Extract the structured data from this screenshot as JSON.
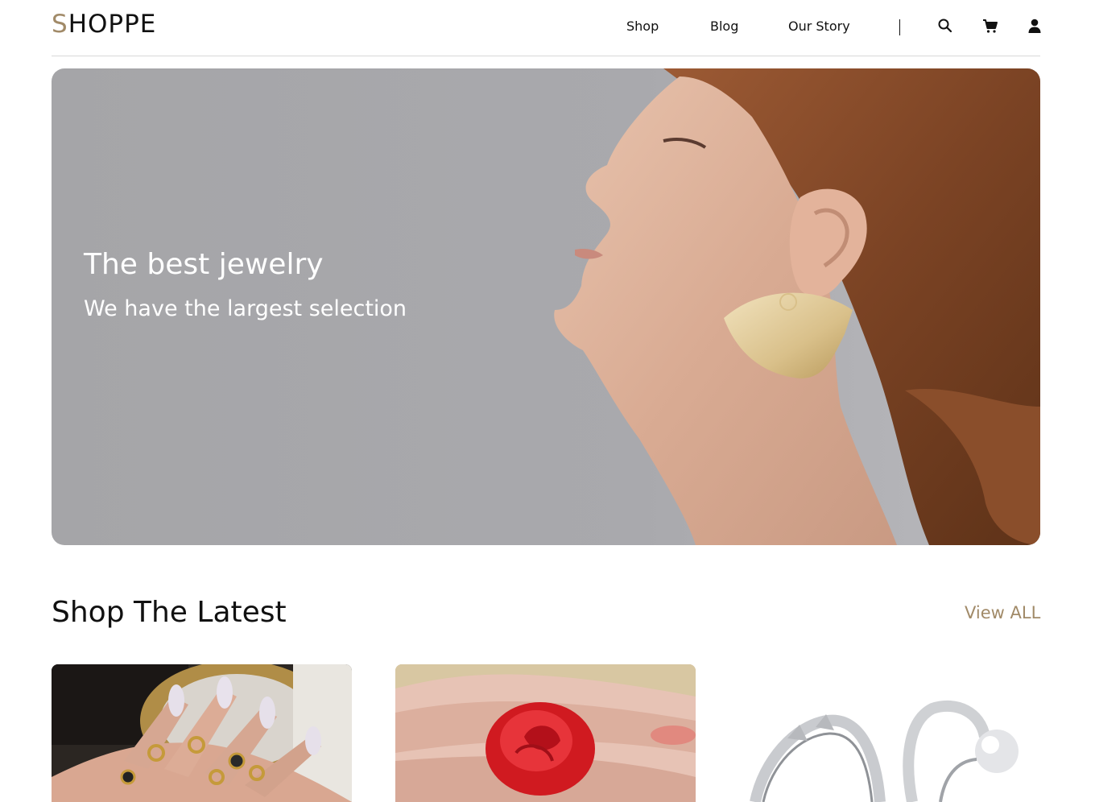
{
  "header": {
    "logo_first": "S",
    "logo_rest": "HOPPE",
    "nav": [
      {
        "label": "Shop"
      },
      {
        "label": "Blog"
      },
      {
        "label": "Our Story"
      }
    ],
    "icons": [
      "search-icon",
      "cart-icon",
      "user-icon"
    ]
  },
  "hero": {
    "title": "The best jewelry",
    "subtitle": "We have the largest selection"
  },
  "latest": {
    "title": "Shop The Latest",
    "view_all": "View ALL",
    "products": [
      {
        "image": "rings-on-hand"
      },
      {
        "image": "red-rose-ring"
      },
      {
        "image": "silver-rings"
      }
    ]
  },
  "colors": {
    "accent": "#a18a68",
    "hero_bg": "#a6a6a9",
    "text": "#111111"
  }
}
